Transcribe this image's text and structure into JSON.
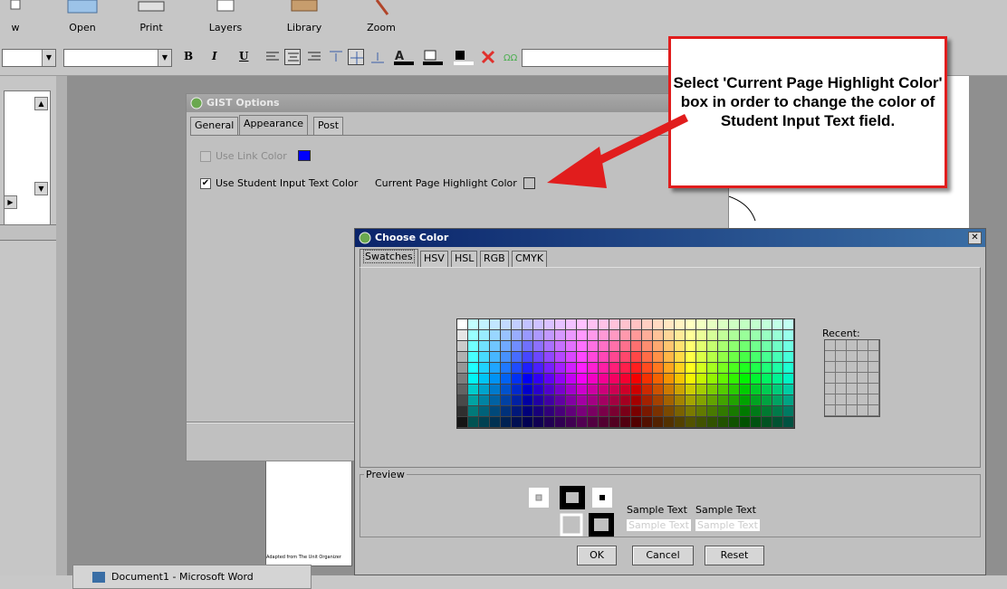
{
  "toolbar": {
    "buttons": [
      {
        "label": "w",
        "icon": "new-icon"
      },
      {
        "label": "Open",
        "icon": "folder-icon"
      },
      {
        "label": "Print",
        "icon": "printer-icon"
      },
      {
        "label": "Layers",
        "icon": "layers-icon"
      },
      {
        "label": "Library",
        "icon": "library-icon"
      },
      {
        "label": "Zoom",
        "icon": "zoom-icon"
      }
    ]
  },
  "format_bar": {
    "bold": "B",
    "italic": "I",
    "underline": "U",
    "icons": [
      "align-left-icon",
      "align-center-icon",
      "align-right-icon",
      "valign-top-icon",
      "valign-middle-icon",
      "valign-bottom-icon",
      "text-color-icon",
      "fill-color-icon",
      "line-color-icon",
      "delete-icon",
      "spell-icon"
    ]
  },
  "gist_options": {
    "title": "GIST Options",
    "tabs": [
      "General",
      "Appearance",
      "Post"
    ],
    "active_tab": "Appearance",
    "use_link_color": {
      "label": "Use Link Color",
      "checked": false,
      "enabled": false,
      "swatch": "#0000ff"
    },
    "use_student_input": {
      "label": "Use Student Input Text Color",
      "checked": true
    },
    "highlight_label": "Current Page Highlight Color"
  },
  "choose_color": {
    "title": "Choose Color",
    "tabs": [
      "Swatches",
      "HSV",
      "HSL",
      "RGB",
      "CMYK"
    ],
    "active_tab": "Swatches",
    "recent_label": "Recent:",
    "preview_label": "Preview",
    "sample_text": "Sample Text",
    "buttons": {
      "ok": "OK",
      "cancel": "Cancel",
      "reset": "Reset"
    }
  },
  "callout": {
    "text": "Select 'Current Page Highlight Color' box in order to change the color of Student Input Text field.",
    "border_color": "#e11d1d"
  },
  "background_doc": {
    "footer_text": "Adapted from The Unit Organizer"
  },
  "taskbar": {
    "item_label": "Document1 - Microsoft Word"
  }
}
